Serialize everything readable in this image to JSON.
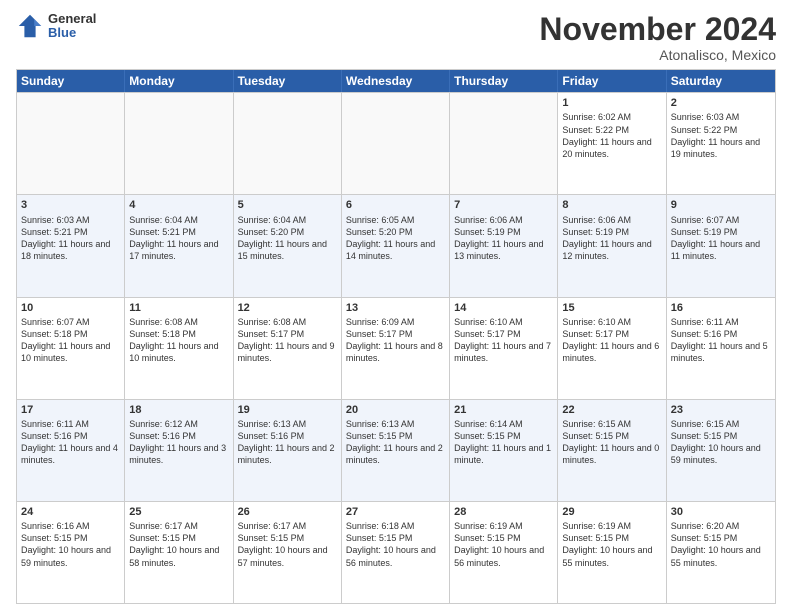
{
  "header": {
    "logo": {
      "general": "General",
      "blue": "Blue"
    },
    "title": "November 2024",
    "location": "Atonalisco, Mexico"
  },
  "calendar": {
    "days": [
      "Sunday",
      "Monday",
      "Tuesday",
      "Wednesday",
      "Thursday",
      "Friday",
      "Saturday"
    ],
    "rows": [
      [
        {
          "day": "",
          "empty": true
        },
        {
          "day": "",
          "empty": true
        },
        {
          "day": "",
          "empty": true
        },
        {
          "day": "",
          "empty": true
        },
        {
          "day": "",
          "empty": true
        },
        {
          "day": "1",
          "sunrise": "6:02 AM",
          "sunset": "5:22 PM",
          "daylight": "11 hours and 20 minutes."
        },
        {
          "day": "2",
          "sunrise": "6:03 AM",
          "sunset": "5:22 PM",
          "daylight": "11 hours and 19 minutes."
        }
      ],
      [
        {
          "day": "3",
          "sunrise": "6:03 AM",
          "sunset": "5:21 PM",
          "daylight": "11 hours and 18 minutes."
        },
        {
          "day": "4",
          "sunrise": "6:04 AM",
          "sunset": "5:21 PM",
          "daylight": "11 hours and 17 minutes."
        },
        {
          "day": "5",
          "sunrise": "6:04 AM",
          "sunset": "5:20 PM",
          "daylight": "11 hours and 15 minutes."
        },
        {
          "day": "6",
          "sunrise": "6:05 AM",
          "sunset": "5:20 PM",
          "daylight": "11 hours and 14 minutes."
        },
        {
          "day": "7",
          "sunrise": "6:06 AM",
          "sunset": "5:19 PM",
          "daylight": "11 hours and 13 minutes."
        },
        {
          "day": "8",
          "sunrise": "6:06 AM",
          "sunset": "5:19 PM",
          "daylight": "11 hours and 12 minutes."
        },
        {
          "day": "9",
          "sunrise": "6:07 AM",
          "sunset": "5:19 PM",
          "daylight": "11 hours and 11 minutes."
        }
      ],
      [
        {
          "day": "10",
          "sunrise": "6:07 AM",
          "sunset": "5:18 PM",
          "daylight": "11 hours and 10 minutes."
        },
        {
          "day": "11",
          "sunrise": "6:08 AM",
          "sunset": "5:18 PM",
          "daylight": "11 hours and 10 minutes."
        },
        {
          "day": "12",
          "sunrise": "6:08 AM",
          "sunset": "5:17 PM",
          "daylight": "11 hours and 9 minutes."
        },
        {
          "day": "13",
          "sunrise": "6:09 AM",
          "sunset": "5:17 PM",
          "daylight": "11 hours and 8 minutes."
        },
        {
          "day": "14",
          "sunrise": "6:10 AM",
          "sunset": "5:17 PM",
          "daylight": "11 hours and 7 minutes."
        },
        {
          "day": "15",
          "sunrise": "6:10 AM",
          "sunset": "5:17 PM",
          "daylight": "11 hours and 6 minutes."
        },
        {
          "day": "16",
          "sunrise": "6:11 AM",
          "sunset": "5:16 PM",
          "daylight": "11 hours and 5 minutes."
        }
      ],
      [
        {
          "day": "17",
          "sunrise": "6:11 AM",
          "sunset": "5:16 PM",
          "daylight": "11 hours and 4 minutes."
        },
        {
          "day": "18",
          "sunrise": "6:12 AM",
          "sunset": "5:16 PM",
          "daylight": "11 hours and 3 minutes."
        },
        {
          "day": "19",
          "sunrise": "6:13 AM",
          "sunset": "5:16 PM",
          "daylight": "11 hours and 2 minutes."
        },
        {
          "day": "20",
          "sunrise": "6:13 AM",
          "sunset": "5:15 PM",
          "daylight": "11 hours and 2 minutes."
        },
        {
          "day": "21",
          "sunrise": "6:14 AM",
          "sunset": "5:15 PM",
          "daylight": "11 hours and 1 minute."
        },
        {
          "day": "22",
          "sunrise": "6:15 AM",
          "sunset": "5:15 PM",
          "daylight": "11 hours and 0 minutes."
        },
        {
          "day": "23",
          "sunrise": "6:15 AM",
          "sunset": "5:15 PM",
          "daylight": "10 hours and 59 minutes."
        }
      ],
      [
        {
          "day": "24",
          "sunrise": "6:16 AM",
          "sunset": "5:15 PM",
          "daylight": "10 hours and 59 minutes."
        },
        {
          "day": "25",
          "sunrise": "6:17 AM",
          "sunset": "5:15 PM",
          "daylight": "10 hours and 58 minutes."
        },
        {
          "day": "26",
          "sunrise": "6:17 AM",
          "sunset": "5:15 PM",
          "daylight": "10 hours and 57 minutes."
        },
        {
          "day": "27",
          "sunrise": "6:18 AM",
          "sunset": "5:15 PM",
          "daylight": "10 hours and 56 minutes."
        },
        {
          "day": "28",
          "sunrise": "6:19 AM",
          "sunset": "5:15 PM",
          "daylight": "10 hours and 56 minutes."
        },
        {
          "day": "29",
          "sunrise": "6:19 AM",
          "sunset": "5:15 PM",
          "daylight": "10 hours and 55 minutes."
        },
        {
          "day": "30",
          "sunrise": "6:20 AM",
          "sunset": "5:15 PM",
          "daylight": "10 hours and 55 minutes."
        }
      ]
    ]
  }
}
